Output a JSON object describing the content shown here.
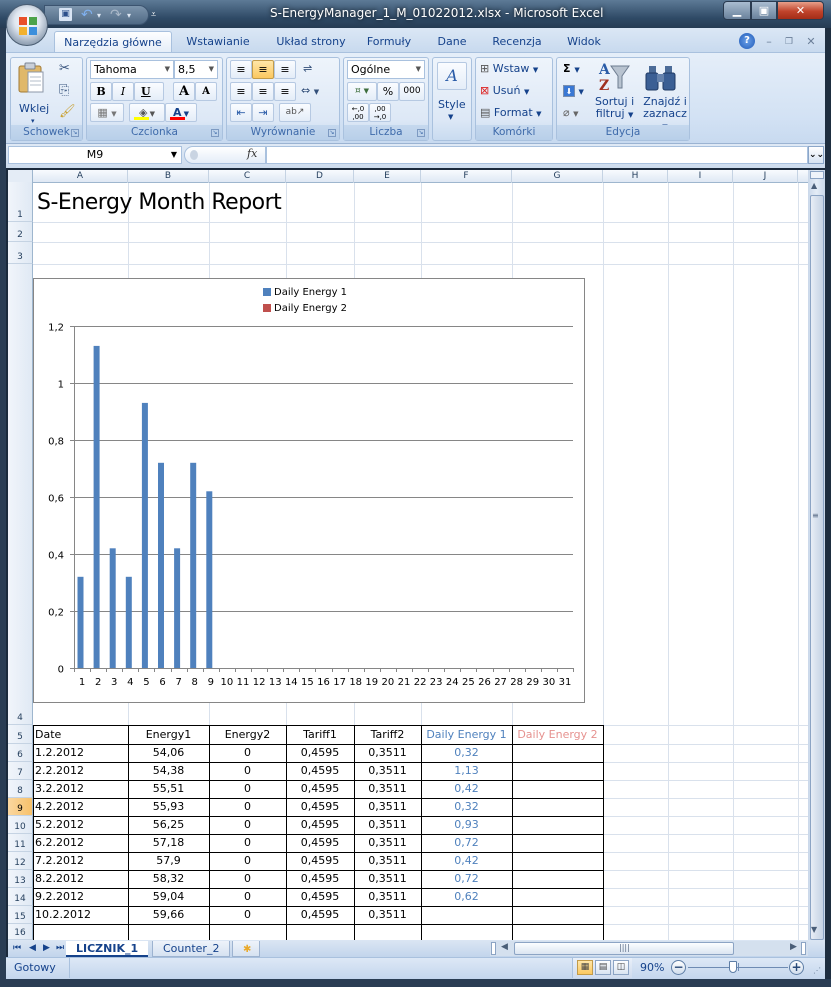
{
  "window": {
    "title": "S-EnergyManager_1_M_01022012.xlsx - Microsoft Excel",
    "minimize_icon": "minimize-icon",
    "maximize_icon": "maximize-icon",
    "close_icon": "close-icon"
  },
  "quick_access": {
    "save": "💾",
    "undo": "↶",
    "redo": "↷",
    "dropdown": "▾",
    "customize": "⩡"
  },
  "ribbon": {
    "tabs": [
      "Narzędzia główne",
      "Wstawianie",
      "Układ strony",
      "Formuły",
      "Dane",
      "Recenzja",
      "Widok"
    ],
    "active_tab": "Narzędzia główne",
    "help": "?",
    "doc_min": "–",
    "doc_restore": "❐",
    "doc_close": "✕",
    "groups": {
      "clipboard": {
        "label": "Schowek",
        "paste": "Wklej",
        "paste_dd": "▾",
        "cut": "✂",
        "copy": "⎘",
        "format_painter": "🖌"
      },
      "font": {
        "label": "Czcionka",
        "font_name": "Tahoma",
        "font_size": "8,5",
        "bold": "B",
        "italic": "I",
        "underline": "U",
        "grow": "A",
        "shrink": "A",
        "borders": "▦",
        "fill": "◈",
        "font_color": "A",
        "fill_color": "#ffff00",
        "text_color": "#ff0000"
      },
      "alignment": {
        "label": "Wyrównanie",
        "top": "≡",
        "middle": "≡",
        "bottom": "≡",
        "wrap": "⇌",
        "left": "≡",
        "center": "≡",
        "right": "≡",
        "merge": "⇔",
        "dec_indent": "⇤",
        "inc_indent": "⇥",
        "orientation": "ab↗"
      },
      "number": {
        "label": "Liczba",
        "format": "Ogólne",
        "currency": "💱",
        "percent": "%",
        "thousands": "000",
        "inc_decimal": "←,0\n,00",
        "dec_decimal": ",00\n→,0"
      },
      "styles": {
        "label": "",
        "style": "Style"
      },
      "cells": {
        "label": "Komórki",
        "insert": "Wstaw",
        "delete": "Usuń",
        "format": "Format"
      },
      "editing": {
        "label": "Edycja",
        "autosum": "Σ",
        "fill": "⬇",
        "clear": "⌫",
        "sort": "Sortuj i\nfiltruj",
        "sort_line1": "Sortuj i",
        "sort_line2": "filtruj",
        "find_line1": "Znajdź i",
        "find_line2": "zaznacz"
      }
    }
  },
  "formula_bar": {
    "name_box": "M9",
    "fx": "fx",
    "formula": "",
    "expand": "»"
  },
  "sheet": {
    "columns": [
      "A",
      "B",
      "C",
      "D",
      "E",
      "F",
      "G",
      "H",
      "I",
      "J"
    ],
    "rows": [
      "1",
      "2",
      "3",
      "4",
      "5",
      "6",
      "7",
      "8",
      "9",
      "10",
      "11",
      "12",
      "13",
      "14",
      "15",
      "16"
    ],
    "selected_row": "9",
    "title": "S-Energy Month Report",
    "table": {
      "headers": [
        "Date",
        "Energy1",
        "Energy2",
        "Tariff1",
        "Tariff2",
        "Daily Energy 1",
        "Daily Energy 2"
      ],
      "header_colors": {
        "daily1": "#4f81bd",
        "daily2": "#e6928f"
      },
      "rows": [
        [
          "1.2.2012",
          "54,06",
          "0",
          "0,4595",
          "0,3511",
          "0,32",
          ""
        ],
        [
          "2.2.2012",
          "54,38",
          "0",
          "0,4595",
          "0,3511",
          "1,13",
          ""
        ],
        [
          "3.2.2012",
          "55,51",
          "0",
          "0,4595",
          "0,3511",
          "0,42",
          ""
        ],
        [
          "4.2.2012",
          "55,93",
          "0",
          "0,4595",
          "0,3511",
          "0,32",
          ""
        ],
        [
          "5.2.2012",
          "56,25",
          "0",
          "0,4595",
          "0,3511",
          "0,93",
          ""
        ],
        [
          "6.2.2012",
          "57,18",
          "0",
          "0,4595",
          "0,3511",
          "0,72",
          ""
        ],
        [
          "7.2.2012",
          "57,9",
          "0",
          "0,4595",
          "0,3511",
          "0,42",
          ""
        ],
        [
          "8.2.2012",
          "58,32",
          "0",
          "0,4595",
          "0,3511",
          "0,72",
          ""
        ],
        [
          "9.2.2012",
          "59,04",
          "0",
          "0,4595",
          "0,3511",
          "0,62",
          ""
        ],
        [
          "10.2.2012",
          "59,66",
          "0",
          "0,4595",
          "0,3511",
          "",
          ""
        ],
        [
          "",
          "",
          "",
          "",
          "",
          "",
          ""
        ]
      ]
    }
  },
  "chart_data": {
    "type": "bar",
    "title": "",
    "xlabel": "",
    "ylabel": "",
    "categories": [
      "1",
      "2",
      "3",
      "4",
      "5",
      "6",
      "7",
      "8",
      "9",
      "10",
      "11",
      "12",
      "13",
      "14",
      "15",
      "16",
      "17",
      "18",
      "19",
      "20",
      "21",
      "22",
      "23",
      "24",
      "25",
      "26",
      "27",
      "28",
      "29",
      "30",
      "31"
    ],
    "series": [
      {
        "name": "Daily Energy 1",
        "color": "#4f81bd",
        "values": [
          0.32,
          1.13,
          0.42,
          0.32,
          0.93,
          0.72,
          0.42,
          0.72,
          0.62,
          null,
          null,
          null,
          null,
          null,
          null,
          null,
          null,
          null,
          null,
          null,
          null,
          null,
          null,
          null,
          null,
          null,
          null,
          null,
          null,
          null,
          null
        ]
      },
      {
        "name": "Daily Energy 2",
        "color": "#c0504d",
        "values": [
          null,
          null,
          null,
          null,
          null,
          null,
          null,
          null,
          null,
          null,
          null,
          null,
          null,
          null,
          null,
          null,
          null,
          null,
          null,
          null,
          null,
          null,
          null,
          null,
          null,
          null,
          null,
          null,
          null,
          null,
          null
        ]
      }
    ],
    "ylim": [
      0,
      1.2
    ],
    "yticks": [
      0,
      0.2,
      0.4,
      0.6,
      0.8,
      1,
      1.2
    ],
    "ytick_labels": [
      "0",
      "0,2",
      "0,4",
      "0,6",
      "0,8",
      "1",
      "1,2"
    ],
    "grid": true,
    "legend_position": "top"
  },
  "sheet_tabs": {
    "nav": [
      "⏮",
      "◀",
      "▶",
      "⏭"
    ],
    "tabs": [
      "LICZNIK_1",
      "Counter_2"
    ],
    "active": "LICZNIK_1",
    "new_sheet": "✱"
  },
  "status_bar": {
    "status": "Gotowy",
    "view_normal": "▦",
    "view_layout": "▤",
    "view_break": "◫",
    "zoom_percent": "90%",
    "zoom_level": 0.9,
    "zoom_minus": "−",
    "zoom_plus": "+"
  }
}
